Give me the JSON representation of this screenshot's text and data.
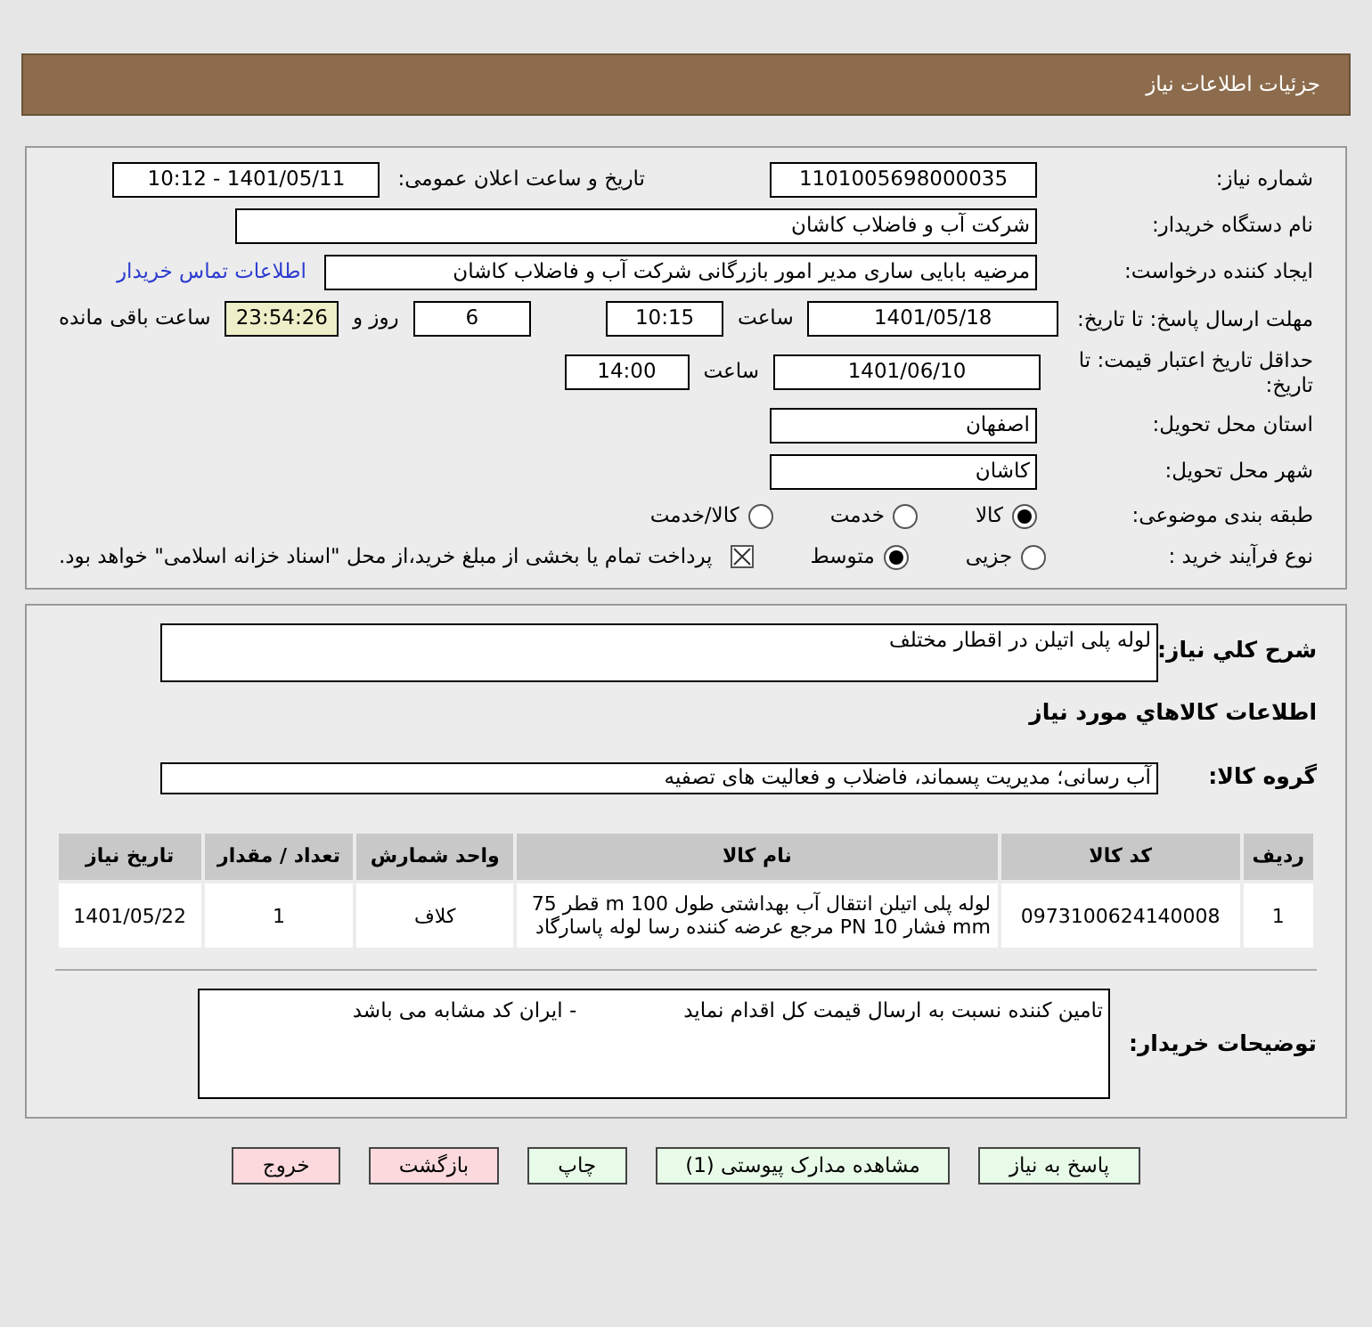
{
  "header": {
    "title": "جزئیات اطلاعات نیاز"
  },
  "need_number": {
    "label": "شماره نیاز:",
    "value": "1101005698000035"
  },
  "announce": {
    "label": "تاریخ و ساعت اعلان عمومی:",
    "value": "1401/05/11 - 10:12"
  },
  "buyer": {
    "label": "نام دستگاه خریدار:",
    "value": "شرکت آب و فاضلاب کاشان"
  },
  "requester": {
    "label": "ایجاد کننده درخواست:",
    "value": "مرضیه بابایی ساری مدیر امور بازرگانی شرکت آب و فاضلاب کاشان",
    "link": "اطلاعات تماس خریدار"
  },
  "deadline": {
    "label": "مهلت ارسال پاسخ: تا تاریخ:",
    "date": "1401/05/18",
    "time_label": "ساعت",
    "time": "10:15",
    "days": "6",
    "days_label": "روز و",
    "remaining": "23:54:26",
    "remaining_label": "ساعت باقی مانده"
  },
  "validity": {
    "label": "حداقل تاریخ اعتبار قیمت: تا تاریخ:",
    "date": "1401/06/10",
    "time_label": "ساعت",
    "time": "14:00"
  },
  "province": {
    "label": "استان محل تحویل:",
    "value": "اصفهان"
  },
  "city": {
    "label": "شهر محل تحویل:",
    "value": "کاشان"
  },
  "category": {
    "label": "طبقه بندی موضوعی:",
    "options": [
      {
        "label": "کالا",
        "selected": true
      },
      {
        "label": "خدمت",
        "selected": false
      },
      {
        "label": "کالا/خدمت",
        "selected": false
      }
    ]
  },
  "process": {
    "label": "نوع فرآیند خرید :",
    "options": [
      {
        "label": "جزیی",
        "selected": false
      },
      {
        "label": "متوسط",
        "selected": true
      }
    ],
    "payment": {
      "label": "پرداخت تمام یا بخشی از مبلغ خرید،از محل \"اسناد خزانه اسلامی\" خواهد بود.",
      "checked": true
    }
  },
  "summary": {
    "label": "شرح کلي نياز:",
    "value": "لوله پلی اتیلن در اقطار مختلف"
  },
  "goods_title": "اطلاعات کالاهاي مورد نياز",
  "group": {
    "label": "گروه کالا:",
    "value": "آب رسانی؛ مدیریت پسماند، فاضلاب و فعالیت های تصفیه"
  },
  "table": {
    "columns": [
      "ردیف",
      "کد کالا",
      "نام کالا",
      "واحد شمارش",
      "تعداد / مقدار",
      "تاریخ نیاز"
    ],
    "rows": [
      [
        "1",
        "0973100624140008",
        "لوله پلی اتیلن انتقال آب بهداشتی طول 100 m قطر 75 mm فشار 10 PN مرجع عرضه کننده رسا لوله پاسارگاد",
        "کلاف",
        "1",
        "1401/05/22"
      ]
    ]
  },
  "notes": {
    "label": "توضیحات خریدار:",
    "lines": [
      "تامین کننده نسبت به ارسال قیمت کل اقدام نماید",
      "- ایران کد مشابه می باشد"
    ]
  },
  "buttons": [
    {
      "label": "پاسخ به نیاز",
      "kind": "normal"
    },
    {
      "label": "مشاهده مدارک پیوستی (1)",
      "kind": "normal"
    },
    {
      "label": "چاپ",
      "kind": "normal"
    },
    {
      "label": "بازگشت",
      "kind": "danger"
    },
    {
      "label": "خروج",
      "kind": "danger"
    }
  ]
}
